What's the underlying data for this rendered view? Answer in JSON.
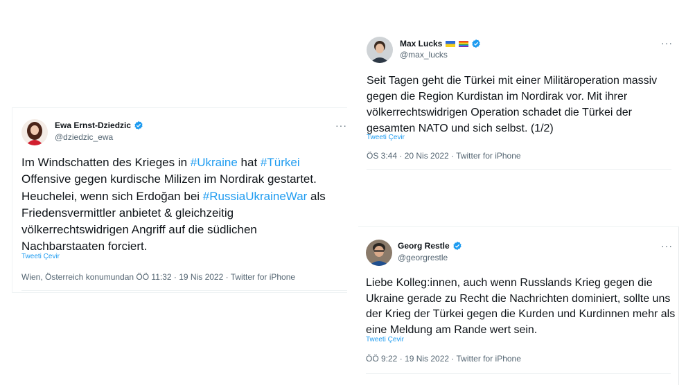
{
  "tweets": {
    "ewa": {
      "name": "Ewa Ernst-Dziedzic",
      "handle": "@dziedzic_ewa",
      "more": "···",
      "body_1": "Im Windschatten des Krieges in ",
      "tag_1": "#Ukraine",
      "body_2": " hat ",
      "tag_2": "#Türkei",
      "body_3": " Offensive gegen kurdische Milizen im Nordirak gestartet. Heuchelei, wenn sich Erdoğan bei ",
      "tag_3": "#RussiaUkraineWar",
      "body_4": " als Friedensvermittler anbietet & gleichzeitig völkerrechtswidrigen Angriff auf die südlichen Nachbarstaaten forciert.",
      "translate": "Tweeti Çevir",
      "meta": "Wien, Österreich konumundan ÖÖ 11:32 · 19 Nis 2022 · Twitter for iPhone"
    },
    "max": {
      "name": "Max Lucks",
      "handle": "@max_lucks",
      "more": "···",
      "body": "Seit Tagen geht die Türkei mit einer Militäroperation massiv gegen die Region Kurdistan im Nordirak vor. Mit ihrer völkerrechtswidrigen Operation schadet die Türkei der gesamten NATO und sich selbst. (1/2)",
      "translate": "Tweeti Çevir",
      "meta": "ÖS 3:44 · 20 Nis 2022 · Twitter for iPhone"
    },
    "georg": {
      "name": "Georg Restle",
      "handle": "@georgrestle",
      "more": "···",
      "body": "Liebe Kolleg:innen, auch wenn Russlands Krieg gegen die Ukraine gerade zu Recht die Nachrichten dominiert, sollte uns der Krieg der Türkei gegen die Kurden und Kurdinnen mehr als eine Meldung am Rande wert sein.",
      "translate": "Tweeti Çevir",
      "meta": "ÖÖ 9:22 · 19 Nis 2022 · Twitter for iPhone"
    }
  },
  "icons": {
    "verified": "verified-badge-icon",
    "more": "more-options-icon",
    "flag_ukraine": "ukraine-flag-icon",
    "flag_rainbow": "rainbow-flag-icon"
  },
  "colors": {
    "link": "#1d9bf0",
    "text": "#0f1419",
    "secondary": "#536471",
    "verified": "#1d9bf0"
  }
}
